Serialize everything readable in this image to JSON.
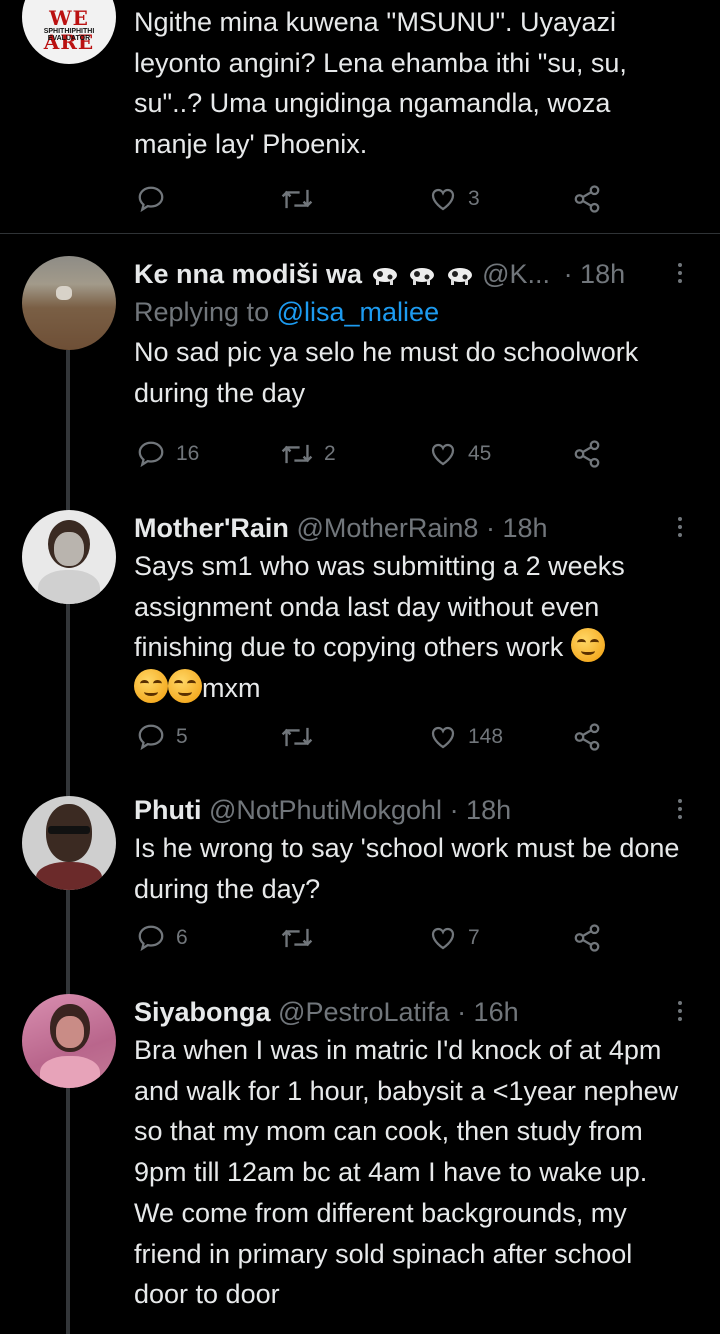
{
  "top_tweet": {
    "avatar_text": "SPHITHIPHITHI EVALUATOR",
    "text": "Ngithe mina kuwena ''MSUNU\". Uyayazi leyonto angini? Lena ehamba ithi \"su, su, su\"..? Uma ungidinga ngamandla, woza manje lay' Phoenix.",
    "likes": "3"
  },
  "tweets": [
    {
      "name": "Ke nna modiši wa",
      "handle": "@K...",
      "time": "· 18h",
      "replying_label": "Replying to",
      "replying_to": "@lisa_maliee",
      "text": "No sad pic  ya selo he must do schoolwork during the day",
      "replies": "16",
      "retweets": "2",
      "likes": "45"
    },
    {
      "name": "Mother'Rain",
      "handle": "@MotherRain8",
      "time": "· 18h",
      "text_a": "Says sm1 who was submitting a 2 weeks assignment onda last day without even finishing due to copying others work",
      "text_b": "mxm",
      "replies": "5",
      "retweets": "",
      "likes": "148"
    },
    {
      "name": "Phuti",
      "handle": "@NotPhutiMokgohl",
      "time": "· 18h",
      "text": "Is he wrong to say 'school work must be done during the day?",
      "replies": "6",
      "retweets": "",
      "likes": "7"
    },
    {
      "name": "Siyabonga",
      "handle": "@PestroLatifa",
      "time": "· 16h",
      "text": "Bra when I was in matric I'd knock of at 4pm and walk for 1 hour, babysit a <1year nephew so that my mom can cook, then study from 9pm till 12am bc at 4am I have to wake up. We come from different backgrounds, my friend in primary sold spinach after school door to door"
    }
  ],
  "colors": {
    "background": "#000000",
    "text": "#e7e9ea",
    "muted": "#71767b",
    "link": "#1d9bf0",
    "divider": "#2f3336"
  }
}
